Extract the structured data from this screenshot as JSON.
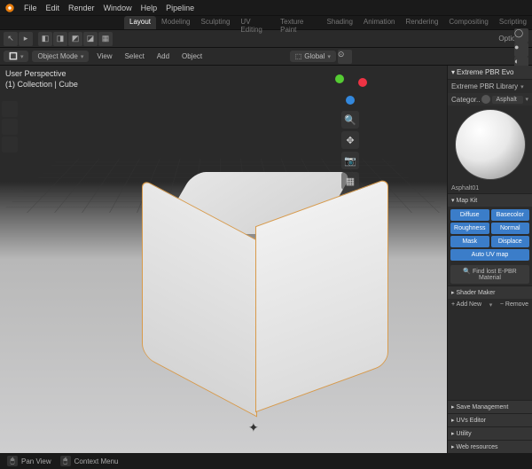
{
  "topbar": {
    "menus": [
      "File",
      "Edit",
      "Render",
      "Window",
      "Help",
      "Pipeline"
    ]
  },
  "workspace_tabs": {
    "items": [
      "Layout",
      "Modeling",
      "Sculpting",
      "UV Editing",
      "Texture Paint",
      "Shading",
      "Animation",
      "Rendering",
      "Compositing",
      "Scripting"
    ],
    "active_index": 0
  },
  "toolbar2": {
    "options": "Options"
  },
  "headerbar": {
    "mode": "Object Mode",
    "menus": [
      "View",
      "Select",
      "Add",
      "Object"
    ],
    "orientation": "Global",
    "pivot": "Median"
  },
  "overlay": {
    "line1": "User Perspective",
    "line2": "(1) Collection | Cube"
  },
  "sidepanel": {
    "title": "Extreme PBR Evo",
    "library_label": "Extreme PBR Library",
    "category_label": "Categor..",
    "category_value": "Asphalt",
    "material_name": "Asphalt01",
    "mapkit_label": "Map Kit",
    "maps": {
      "diffuse": "Diffuse",
      "basecolor": "Basecolor",
      "roughness": "Roughness",
      "normal": "Normal",
      "mask": "Mask",
      "displace": "Displace",
      "autouv": "Auto UV map"
    },
    "find_lost": "Find lost E-PBR Material",
    "shader_maker": "Shader Maker",
    "add_new": "Add New",
    "remove": "Remove",
    "sections": {
      "save": "Save Management",
      "uvs": "UVs Editor",
      "utility": "Utility",
      "web": "Web resources"
    }
  },
  "statusbar": {
    "pan": "Pan View",
    "context": "Context Menu"
  }
}
